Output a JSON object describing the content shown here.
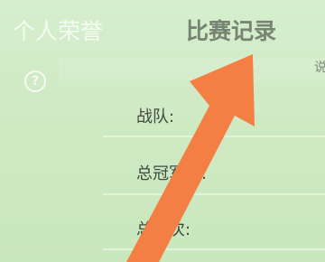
{
  "tabs": {
    "personal_honors": "个人荣誉",
    "match_records": "比赛记录"
  },
  "help_icon": {
    "icon": "question-circle-icon",
    "glyph": "?"
  },
  "corner_text": "说",
  "fields": [
    {
      "label": "战队:"
    },
    {
      "label": "总冠军数:"
    },
    {
      "label": "总场次:"
    }
  ],
  "annotation": {
    "icon": "pointer-arrow-icon",
    "color": "#f47f45"
  }
}
